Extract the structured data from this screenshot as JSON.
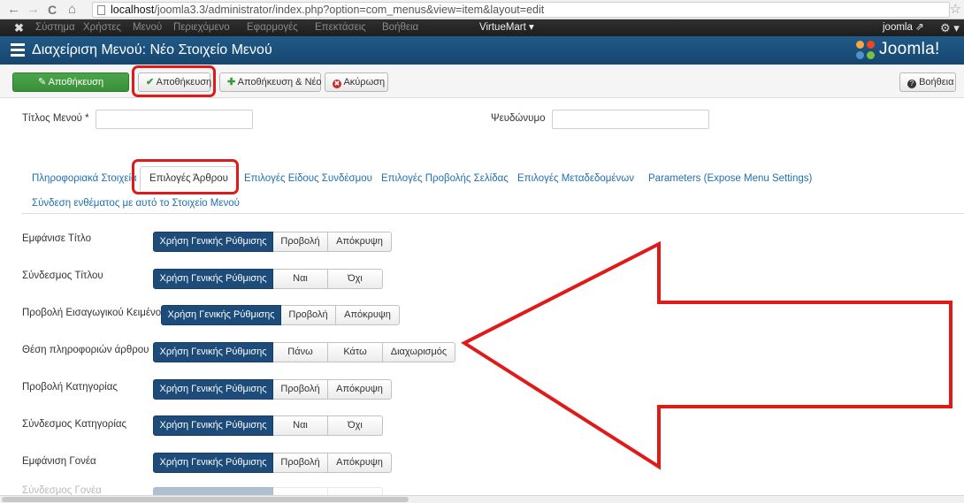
{
  "browser": {
    "back": "←",
    "forward": "→",
    "reload": "C",
    "home": "⌂",
    "url_host": "localhost",
    "url_rest": "/joomla3.3/administrator/index.php?option=com_menus&view=item&layout=edit",
    "star": "☆"
  },
  "topnav": {
    "logo_glyph": "✖",
    "items": [
      "Σύστημα",
      "Χρήστες",
      "Μενού",
      "Περιεχόμενο",
      "Εφαρμογές",
      "Επεκτάσεις",
      "Βοήθεια"
    ],
    "virtuemart": "VirtueMart ▾",
    "user": "joomla ⇗",
    "settings": "⚙ ▾"
  },
  "header": {
    "title": "Διαχείριση Μενού: Νέο Στοιχείο Μενού",
    "logo_text": "Joomla!"
  },
  "toolbar": {
    "save_icon": "✎",
    "save": "Αποθήκευση",
    "save_close_icon": "✔",
    "save_close": "Αποθήκευση",
    "save_new_icon": "✚",
    "save_new": "Αποθήκευση & Νέο",
    "cancel_icon": "✖",
    "cancel": "Ακύρωση",
    "help_icon": "?",
    "help": "Βοήθεια"
  },
  "form": {
    "menu_title_label": "Τίτλος Μενού *",
    "menu_title_value": "",
    "alias_label": "Ψευδώνυμο",
    "alias_value": ""
  },
  "tabs": [
    "Πληροφοριακά Στοιχεία",
    "Επιλογές Άρθρου",
    "Επιλογές Είδους Συνδέσμου",
    "Επιλογές Προβολής Σελίδας",
    "Επιλογές Μεταδεδομένων",
    "Parameters (Expose Menu Settings)",
    "Σύνδεση ενθέματος με αυτό το Στοιχείο Μενού"
  ],
  "options": [
    {
      "label": "Εμφάνισε Τίτλο",
      "buttons": [
        "Χρήση Γενικής Ρύθμισης",
        "Προβολή",
        "Απόκρυψη"
      ]
    },
    {
      "label": "Σύνδεσμος Τίτλου",
      "buttons": [
        "Χρήση Γενικής Ρύθμισης",
        "Ναι",
        "Όχι"
      ]
    },
    {
      "label": "Προβολή Εισαγωγικού Κειμένου",
      "buttons": [
        "Χρήση Γενικής Ρύθμισης",
        "Προβολή",
        "Απόκρυψη"
      ]
    },
    {
      "label": "Θέση πληροφοριών άρθρου",
      "buttons": [
        "Χρήση Γενικής Ρύθμισης",
        "Πάνω",
        "Κάτω",
        "Διαχωρισμός"
      ]
    },
    {
      "label": "Προβολή Κατηγορίας",
      "buttons": [
        "Χρήση Γενικής Ρύθμισης",
        "Προβολή",
        "Απόκρυψη"
      ]
    },
    {
      "label": "Σύνδεσμος Κατηγορίας",
      "buttons": [
        "Χρήση Γενικής Ρύθμισης",
        "Ναι",
        "Όχι"
      ]
    },
    {
      "label": "Εμφάνιση Γονέα",
      "buttons": [
        "Χρήση Γενικής Ρύθμισης",
        "Προβολή",
        "Απόκρυψη"
      ]
    },
    {
      "label": "Σύνδεσμος Γονέα",
      "buttons": [
        "",
        "",
        ""
      ]
    }
  ],
  "colors": {
    "header_blue": "#1a4f7a",
    "active_segment": "#1d4b7a",
    "save_green": "#3f9b3f",
    "annotation_red": "#e01919",
    "link_blue": "#1f6fb2"
  }
}
